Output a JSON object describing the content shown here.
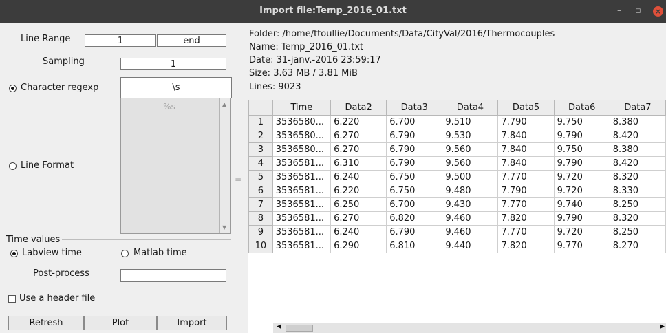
{
  "window": {
    "title": "Import file:Temp_2016_01.txt",
    "minimize": "–",
    "restore": "▫",
    "close": "×"
  },
  "left": {
    "line_range_label": "Line Range",
    "line_range_start": "1",
    "line_range_end": "end",
    "sampling_label": "Sampling",
    "sampling_value": "1",
    "char_regexp_label": "Character regexp",
    "char_regexp_value": "\\s",
    "line_format_label": "Line Format",
    "line_format_placeholder": "%s",
    "time_values_label": "Time values",
    "labview_label": "Labview time",
    "matlab_label": "Matlab time",
    "postprocess_label": "Post-process",
    "postprocess_value": "",
    "header_file_label": "Use a header file",
    "refresh_label": "Refresh",
    "plot_label": "Plot",
    "import_label": "Import"
  },
  "info": {
    "folder": "Folder: /home/ttoullie/Documents/Data/CityVal/2016/Thermocouples",
    "name": "Name: Temp_2016_01.txt",
    "date": "Date: 31-janv.-2016 23:59:17",
    "size": "Size: 3.63 MB / 3.81 MiB",
    "lines": "Lines: 9023"
  },
  "table": {
    "columns": [
      "Time",
      "Data2",
      "Data3",
      "Data4",
      "Data5",
      "Data6",
      "Data7"
    ],
    "rows": [
      [
        "1",
        "3536580...",
        "6.220",
        "6.700",
        "9.510",
        "7.790",
        "9.750",
        "8.380"
      ],
      [
        "2",
        "3536580...",
        "6.270",
        "6.790",
        "9.530",
        "7.840",
        "9.790",
        "8.420"
      ],
      [
        "3",
        "3536580...",
        "6.270",
        "6.790",
        "9.560",
        "7.840",
        "9.750",
        "8.380"
      ],
      [
        "4",
        "3536581...",
        "6.310",
        "6.790",
        "9.560",
        "7.840",
        "9.790",
        "8.420"
      ],
      [
        "5",
        "3536581...",
        "6.240",
        "6.750",
        "9.500",
        "7.770",
        "9.720",
        "8.320"
      ],
      [
        "6",
        "3536581...",
        "6.220",
        "6.750",
        "9.480",
        "7.790",
        "9.720",
        "8.330"
      ],
      [
        "7",
        "3536581...",
        "6.250",
        "6.700",
        "9.430",
        "7.770",
        "9.740",
        "8.250"
      ],
      [
        "8",
        "3536581...",
        "6.270",
        "6.820",
        "9.460",
        "7.820",
        "9.790",
        "8.320"
      ],
      [
        "9",
        "3536581...",
        "6.240",
        "6.790",
        "9.460",
        "7.770",
        "9.720",
        "8.250"
      ],
      [
        "10",
        "3536581...",
        "6.290",
        "6.810",
        "9.440",
        "7.820",
        "9.770",
        "8.270"
      ]
    ]
  }
}
